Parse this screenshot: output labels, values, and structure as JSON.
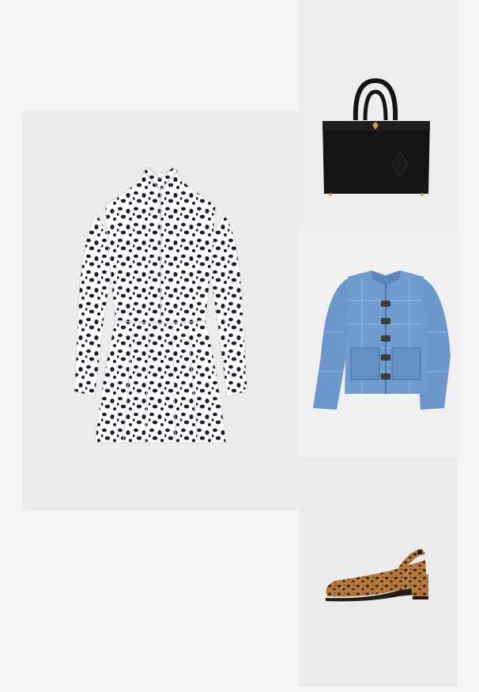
{
  "products": [
    {
      "id": "dress",
      "icon": "dalmatian-print-shirt-dress",
      "colors": {
        "base": "#ffffff",
        "print": "#1c1c2e"
      }
    },
    {
      "id": "bag",
      "icon": "black-leather-tote-bag",
      "colors": {
        "base": "#141414",
        "hardware": "#c9a24a"
      }
    },
    {
      "id": "jacket",
      "icon": "quilted-denim-jacket",
      "colors": {
        "base": "#6b97cc",
        "stitch": "#9fc0e6",
        "buttons": "#3c3b3d"
      }
    },
    {
      "id": "shoe",
      "icon": "leopard-slingback-pump",
      "colors": {
        "base": "#b57a3c",
        "spots": "#3a2412",
        "heel": "#2b1a10"
      }
    }
  ]
}
